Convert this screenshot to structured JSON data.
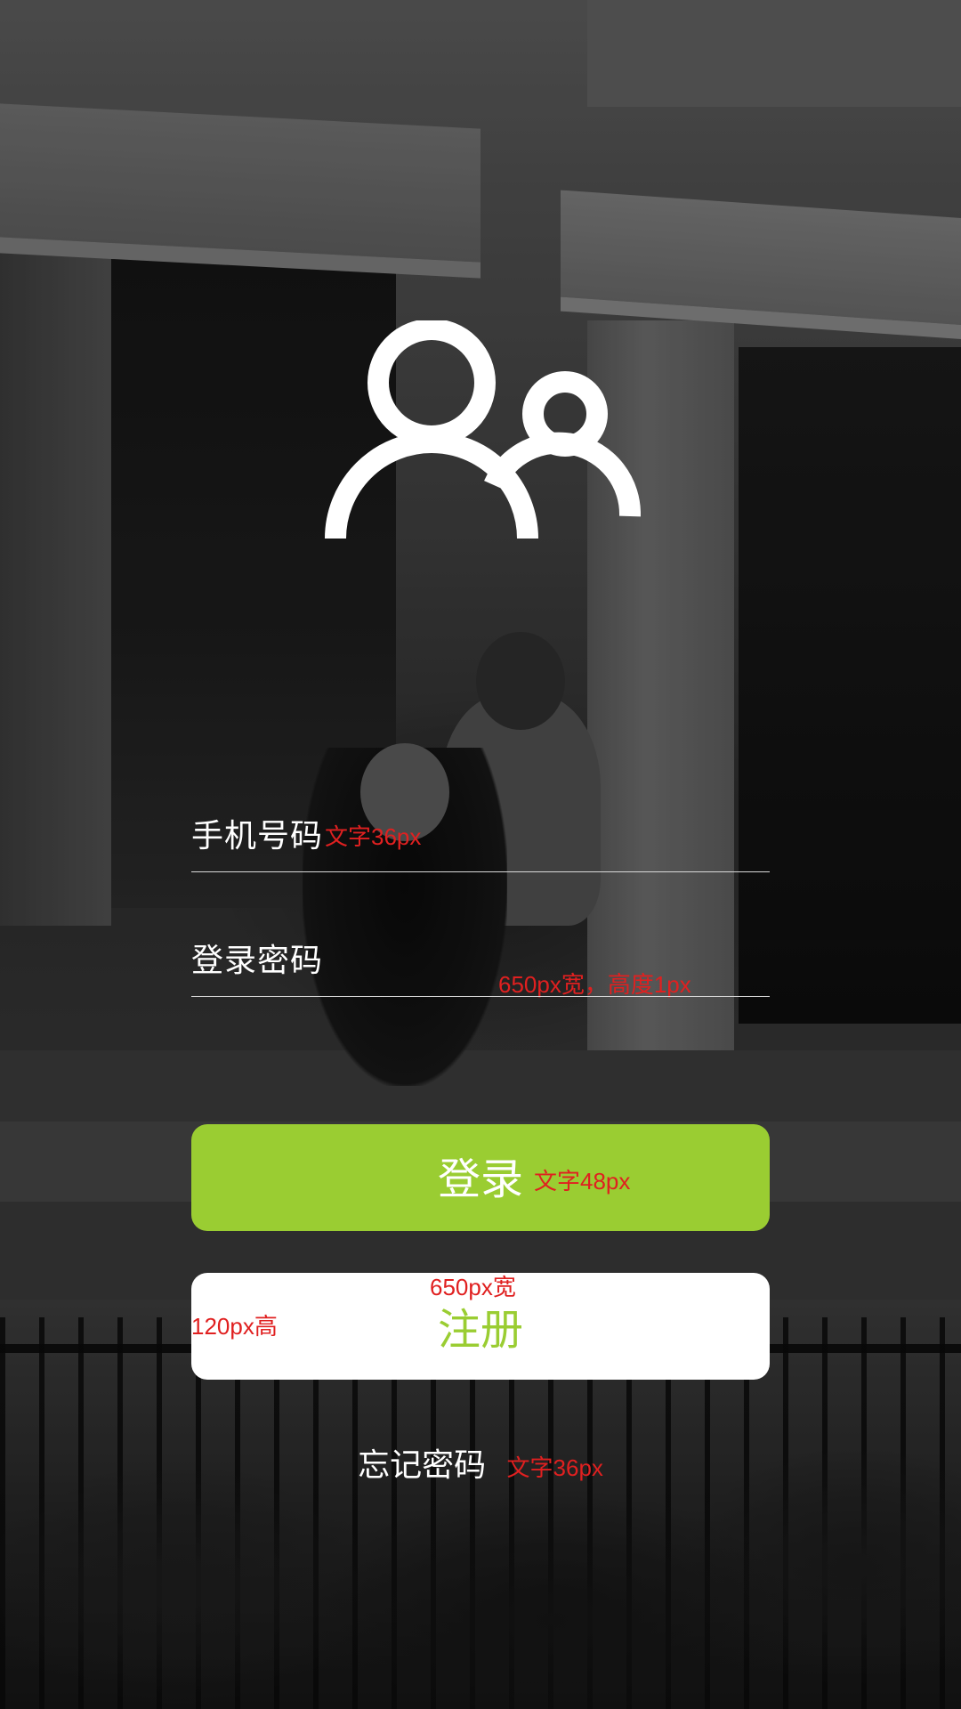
{
  "background": {
    "description_icon": "photo-background",
    "tint": "#2b2b2b"
  },
  "logo": {
    "icon": "users-icon",
    "color": "#ffffff"
  },
  "phone_field": {
    "label": "手机号码",
    "annotation": "文字36px"
  },
  "password_field": {
    "label": "登录密码",
    "annotation": "650px宽，高度1px"
  },
  "login_button": {
    "label": "登录",
    "annotation": "文字48px",
    "color": "#9acd32"
  },
  "register_button": {
    "label": "注册",
    "annotation_width": "650px宽",
    "annotation_height": "120px高",
    "color": "#ffffff",
    "text_color": "#9acd32"
  },
  "forgot_password": {
    "label": "忘记密码",
    "annotation": "文字36px"
  },
  "annotation_color": "#e02020"
}
